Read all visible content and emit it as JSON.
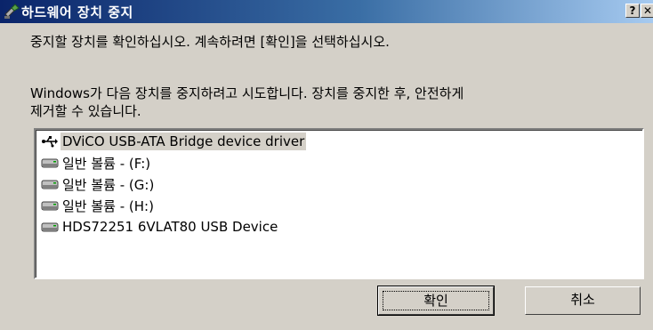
{
  "window": {
    "title": "하드웨어 장치 중지",
    "help_label": "?",
    "close_label": "✕"
  },
  "instructions": {
    "line1": "중지할 장치를 확인하십시오. 계속하려면 [확인]을 선택하십시오.",
    "line2": "Windows가 다음 장치를 중지하려고 시도합니다. 장치를 중지한 후, 안전하게",
    "line3": "제거할 수 있습니다."
  },
  "devices": [
    {
      "label": "DViCO USB-ATA Bridge device driver",
      "icon": "usb-icon",
      "selected": true
    },
    {
      "label": "일반 볼륨 - (F:)",
      "icon": "drive-icon",
      "selected": false
    },
    {
      "label": "일반 볼륨 - (G:)",
      "icon": "drive-icon",
      "selected": false
    },
    {
      "label": "일반 볼륨 - (H:)",
      "icon": "drive-icon",
      "selected": false
    },
    {
      "label": "HDS72251 6VLAT80 USB Device",
      "icon": "drive-icon",
      "selected": false
    }
  ],
  "buttons": {
    "ok_label": "확인",
    "cancel_label": "취소"
  }
}
